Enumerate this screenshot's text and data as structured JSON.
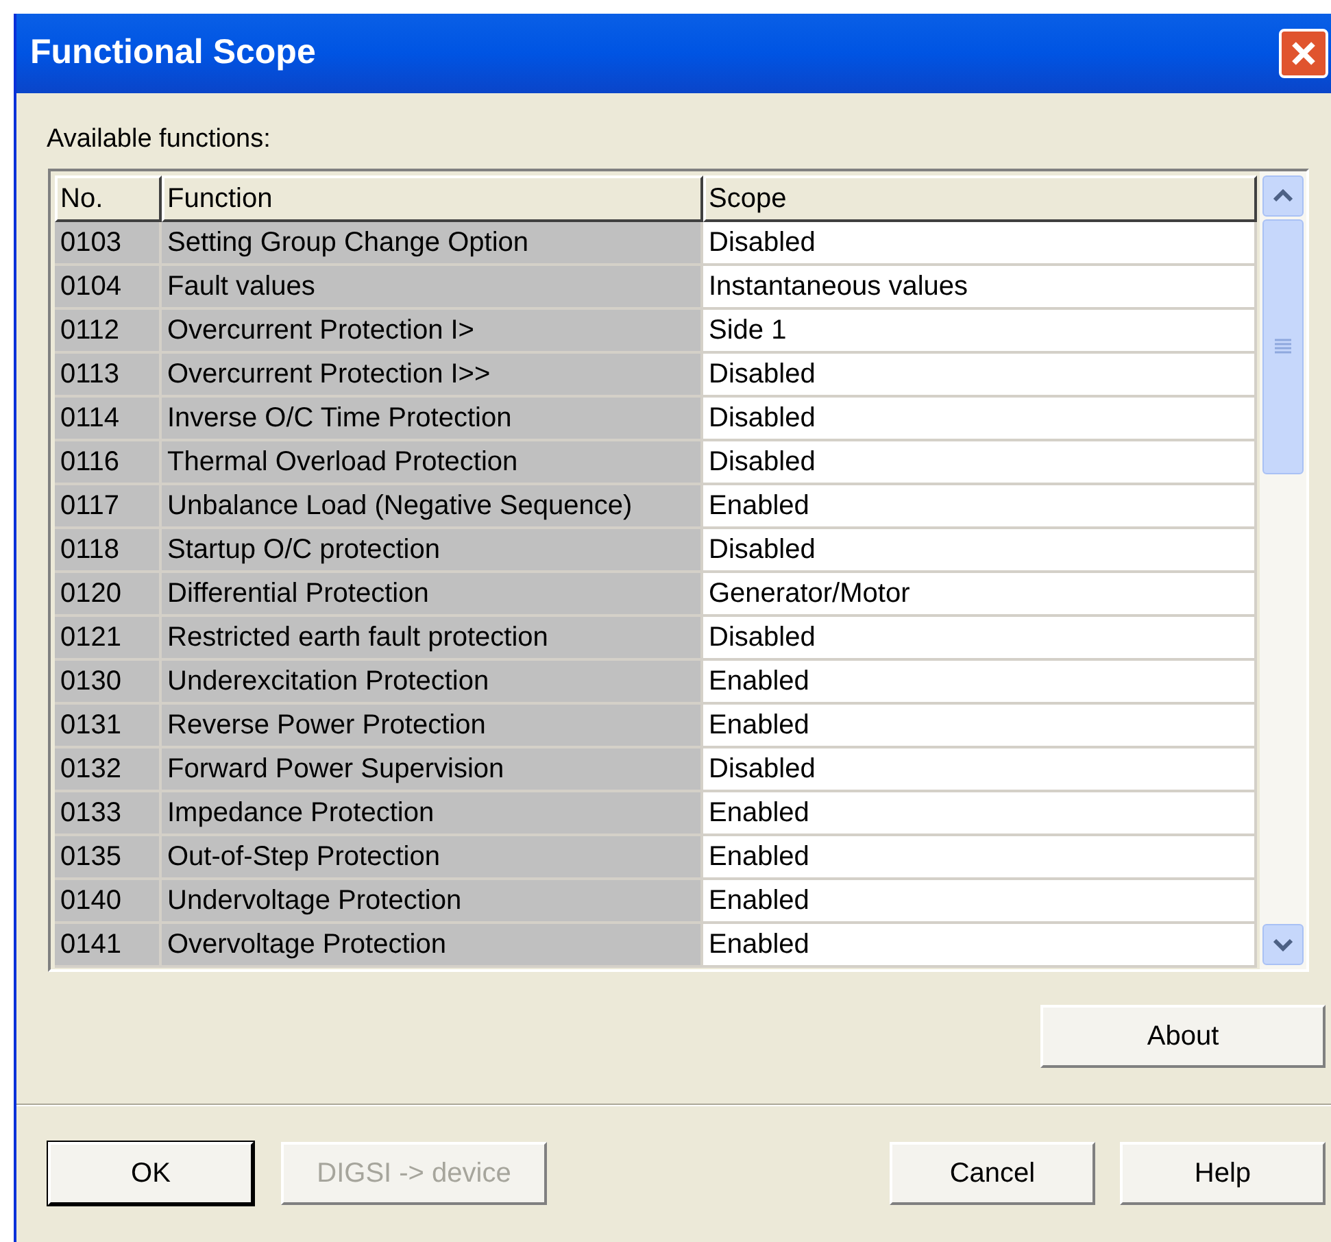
{
  "window": {
    "title": "Functional Scope"
  },
  "list_label": "Available functions:",
  "table": {
    "columns": [
      "No.",
      "Function",
      "Scope"
    ],
    "rows": [
      [
        "0103",
        "Setting Group Change Option",
        "Disabled"
      ],
      [
        "0104",
        "Fault values",
        "Instantaneous values"
      ],
      [
        "0112",
        "Overcurrent Protection I>",
        "Side 1"
      ],
      [
        "0113",
        "Overcurrent Protection I>>",
        "Disabled"
      ],
      [
        "0114",
        "Inverse O/C Time Protection",
        "Disabled"
      ],
      [
        "0116",
        "Thermal Overload Protection",
        "Disabled"
      ],
      [
        "0117",
        "Unbalance Load (Negative Sequence)",
        "Enabled"
      ],
      [
        "0118",
        "Startup O/C protection",
        "Disabled"
      ],
      [
        "0120",
        "Differential Protection",
        "Generator/Motor"
      ],
      [
        "0121",
        "Restricted earth fault protection",
        "Disabled"
      ],
      [
        "0130",
        "Underexcitation Protection",
        "Enabled"
      ],
      [
        "0131",
        "Reverse Power Protection",
        "Enabled"
      ],
      [
        "0132",
        "Forward Power Supervision",
        "Disabled"
      ],
      [
        "0133",
        "Impedance Protection",
        "Enabled"
      ],
      [
        "0135",
        "Out-of-Step Protection",
        "Enabled"
      ],
      [
        "0140",
        "Undervoltage Protection",
        "Enabled"
      ],
      [
        "0141",
        "Overvoltage Protection",
        "Enabled"
      ]
    ]
  },
  "about_button": {
    "label": "About",
    "disabled": false
  },
  "left_buttons": [
    {
      "label": "OK",
      "disabled": false,
      "default": true
    },
    {
      "label": "DIGSI -> device",
      "disabled": true,
      "default": false
    }
  ],
  "right_buttons": [
    {
      "label": "Cancel",
      "disabled": false,
      "default": false
    },
    {
      "label": "Help",
      "disabled": false,
      "default": false
    }
  ]
}
